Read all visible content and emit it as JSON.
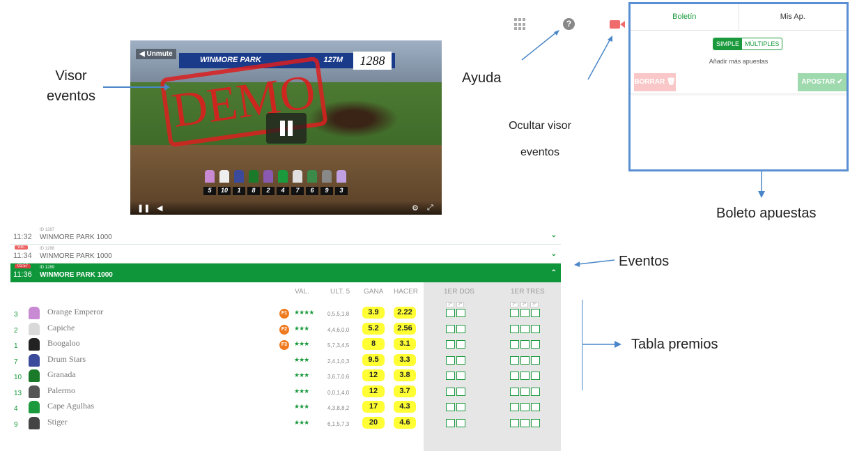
{
  "video": {
    "unmute_label": "◀ Unmute",
    "banner_text": "WINMORE PARK",
    "distance": "127M",
    "race_number": "1288",
    "demo_watermark": "DEMO",
    "jockey_numbers": [
      "5",
      "10",
      "1",
      "8",
      "2",
      "4",
      "7",
      "6",
      "9",
      "3"
    ]
  },
  "annotations": {
    "visor": "Visor\neventos",
    "ayuda": "Ayuda",
    "ocultar": "Ocultar visor eventos",
    "boleto": "Boleto apuestas",
    "eventos": "Eventos",
    "tabla": "Tabla premios"
  },
  "betslip": {
    "tab_boletin": "Boletín",
    "tab_mis_ap": "Mis Ap.",
    "simple": "SIMPLE",
    "multiples": "MÚLTIPLES",
    "add_more": "Añadir más apuestas",
    "borrar": "BORRAR 🗑",
    "apostar": "APOSTAR ✔"
  },
  "events": [
    {
      "time": "11:32",
      "id": "ID 1287",
      "name": "WINMORE PARK 1000",
      "tag": "",
      "active": false
    },
    {
      "time": "11:34",
      "id": "ID 1288",
      "name": "WINMORE PARK 1000",
      "tag": "V.E.",
      "active": false
    },
    {
      "time": "11:36",
      "id": "ID 1289",
      "name": "WINMORE PARK 1000",
      "tag": "01:57",
      "active": true
    }
  ],
  "table": {
    "headers": {
      "val": "VAL.",
      "ult": "ULT. 5",
      "gana": "GANA",
      "hacer": "HACER",
      "dos": "1ER DOS",
      "tres": "1ER TRES"
    },
    "dos_sub": [
      "1º",
      "2º"
    ],
    "tres_sub": [
      "1º",
      "2º",
      "3º"
    ],
    "rows": [
      {
        "num": "3",
        "name": "Orange Emperor",
        "fav": "F1",
        "stars": "★★★★",
        "ult": "0,5,5,1,8",
        "gana": "3.9",
        "hacer": "2.22",
        "silk": "#c98ad4"
      },
      {
        "num": "2",
        "name": "Capiche",
        "fav": "F2",
        "stars": "★★★",
        "ult": "4,4,6,0,0",
        "gana": "5.2",
        "hacer": "2.56",
        "silk": "#d9d9d9"
      },
      {
        "num": "1",
        "name": "Boogaloo",
        "fav": "F3",
        "stars": "★★★",
        "ult": "5,7,3,4,5",
        "gana": "8",
        "hacer": "3.1",
        "silk": "#222222"
      },
      {
        "num": "7",
        "name": "Drum Stars",
        "fav": "",
        "stars": "★★★",
        "ult": "2,4,1,0,3",
        "gana": "9.5",
        "hacer": "3.3",
        "silk": "#3b4a9a"
      },
      {
        "num": "10",
        "name": "Granada",
        "fav": "",
        "stars": "★★★",
        "ult": "3,6,7,0,6",
        "gana": "12",
        "hacer": "3.8",
        "silk": "#1a7a2a"
      },
      {
        "num": "13",
        "name": "Palermo",
        "fav": "",
        "stars": "★★★",
        "ult": "0,0,1,4,0",
        "gana": "12",
        "hacer": "3.7",
        "silk": "#555555"
      },
      {
        "num": "4",
        "name": "Cape Agulhas",
        "fav": "",
        "stars": "★★★",
        "ult": "4,3,8,8,2",
        "gana": "17",
        "hacer": "4.3",
        "silk": "#1a9a3c"
      },
      {
        "num": "9",
        "name": "Stiger",
        "fav": "",
        "stars": "★★★",
        "ult": "6,1,5,7,3",
        "gana": "20",
        "hacer": "4.6",
        "silk": "#444444"
      }
    ]
  },
  "colors": {
    "accent_green": "#10963a",
    "odds_yellow": "#ffff33",
    "annotation_blue": "#4a86c8"
  }
}
